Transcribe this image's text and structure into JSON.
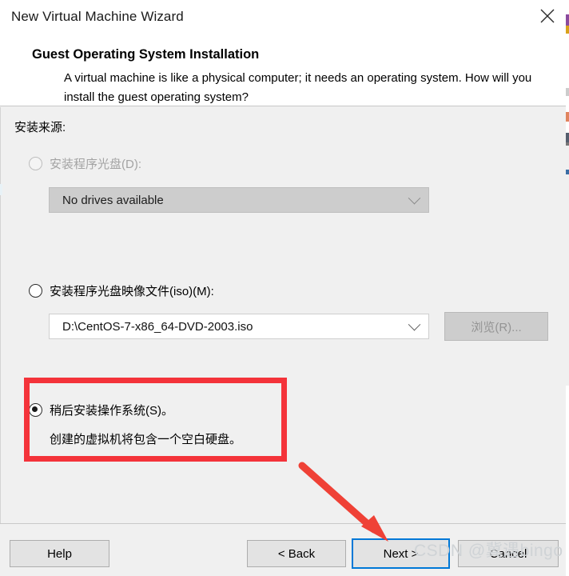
{
  "window": {
    "title": "New Virtual Machine Wizard",
    "close_icon": "close-icon"
  },
  "header": {
    "title": "Guest Operating System Installation",
    "description": "A virtual machine is like a physical computer; it needs an operating system. How will you install the guest operating system?"
  },
  "body": {
    "section_label": "安装来源:",
    "options": [
      {
        "id": "installer-disc",
        "label": "安装程序光盘(D):",
        "selected": false,
        "enabled": false,
        "combo_value": "No drives available"
      },
      {
        "id": "installer-iso",
        "label": "安装程序光盘映像文件(iso)(M):",
        "selected": false,
        "enabled": true,
        "combo_value": "D:\\CentOS-7-x86_64-DVD-2003.iso",
        "browse_label": "浏览(R)..."
      },
      {
        "id": "install-later",
        "label": "稍后安装操作系统(S)。",
        "selected": true,
        "enabled": true,
        "description": "创建的虚拟机将包含一个空白硬盘。"
      }
    ]
  },
  "footer": {
    "help_label": "Help",
    "back_label": "< Back",
    "next_label": "Next >",
    "cancel_label": "Cancel"
  },
  "annotations": {
    "highlight_color": "#f4333a",
    "focus_color": "#0078d7",
    "watermark": "CSDN @冀遇bingo"
  }
}
